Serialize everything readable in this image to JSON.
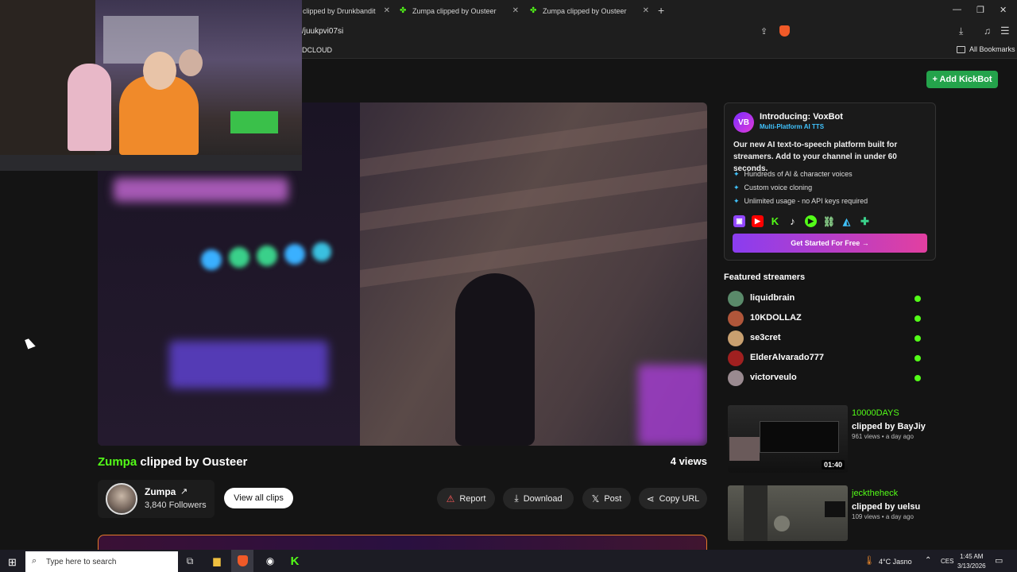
{
  "browser": {
    "tabs": [
      {
        "label": "clipped by Drunkbandit"
      },
      {
        "label": "Zumpa clipped by Ousteer"
      },
      {
        "label": "Zumpa clipped by Ousteer"
      }
    ],
    "new_tab": "+",
    "url": "/juukpvi07si",
    "bookmark_left": "DCLOUD",
    "bookmarks_all": "All Bookmarks"
  },
  "header": {
    "add_kickbot": "+ Add KickBot"
  },
  "clip": {
    "channel": "Zumpa",
    "clipped_by": " clipped by Ousteer",
    "views": "4 views"
  },
  "creator": {
    "name": "Zumpa",
    "followers": "3,840 Followers",
    "view_all": "View all clips"
  },
  "actions": {
    "report": "Report",
    "download": "Download",
    "post": "Post",
    "copy_url": "Copy URL"
  },
  "voxbot": {
    "logo": "VB",
    "title": "Introducing: VoxBot",
    "subtitle": "Multi-Platform AI TTS",
    "description": "Our new AI text-to-speech platform built for streamers. Add to your channel in under 60 seconds.",
    "features": [
      "Hundreds of AI & character voices",
      "Custom voice cloning",
      "Unlimited usage - no API keys required"
    ],
    "cta": "Get Started For Free →"
  },
  "featured": {
    "heading": "Featured streamers",
    "streamers": [
      {
        "name": "liquidbrain",
        "color": "#5a8a6a"
      },
      {
        "name": "10KDOLLAZ",
        "color": "#b0563a"
      },
      {
        "name": "se3cret",
        "color": "#c9a070"
      },
      {
        "name": "ElderAlvarado777",
        "color": "#a02020"
      },
      {
        "name": "victorveulo",
        "color": "#9a8a90"
      }
    ]
  },
  "related": [
    {
      "channel": "10000DAYS",
      "by": "clipped by BayJiy",
      "meta": "961 views • a day ago",
      "duration": "01:40"
    },
    {
      "channel": "jecktheheck",
      "by": "clipped by uelsu",
      "meta": "109 views • a day ago"
    }
  ],
  "taskbar": {
    "search_placeholder": "Type here to search",
    "weather": "4°C  Jasno",
    "lang": "CES",
    "time": "1:45 AM",
    "date": "3/13/2026"
  },
  "colors": {
    "kick_green": "#53fc18",
    "vox_cyan": "#40c4ff"
  }
}
